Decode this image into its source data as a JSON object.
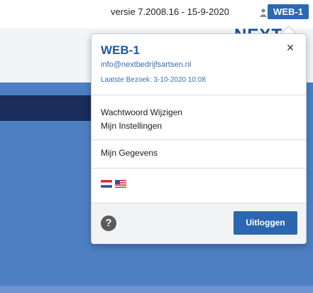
{
  "topbar": {
    "version_text": "versie 7.2008.16 - 15-9-2020",
    "user_badge": "WEB-1",
    "logo_partial": "NEXT"
  },
  "popover": {
    "title": "WEB-1",
    "email": "info@nextbedrijfsartsen.nl",
    "last_visit": "Laatste Bezoek: 3-10-2020 10:08",
    "close_symbol": "×",
    "menu": [
      {
        "label": "Wachtwoord Wijzigen"
      },
      {
        "label": "Mijn Instellingen"
      },
      {
        "label": "Mijn Gegevens"
      }
    ],
    "flags": [
      {
        "icon": "dutch-flag-icon"
      },
      {
        "icon": "us-flag-icon"
      }
    ],
    "help_symbol": "?",
    "logout_label": "Uitloggen"
  },
  "colors": {
    "accent": "#2a67b0",
    "band_blue": "#4e7fc3",
    "band_navy": "#1a2d5c"
  }
}
